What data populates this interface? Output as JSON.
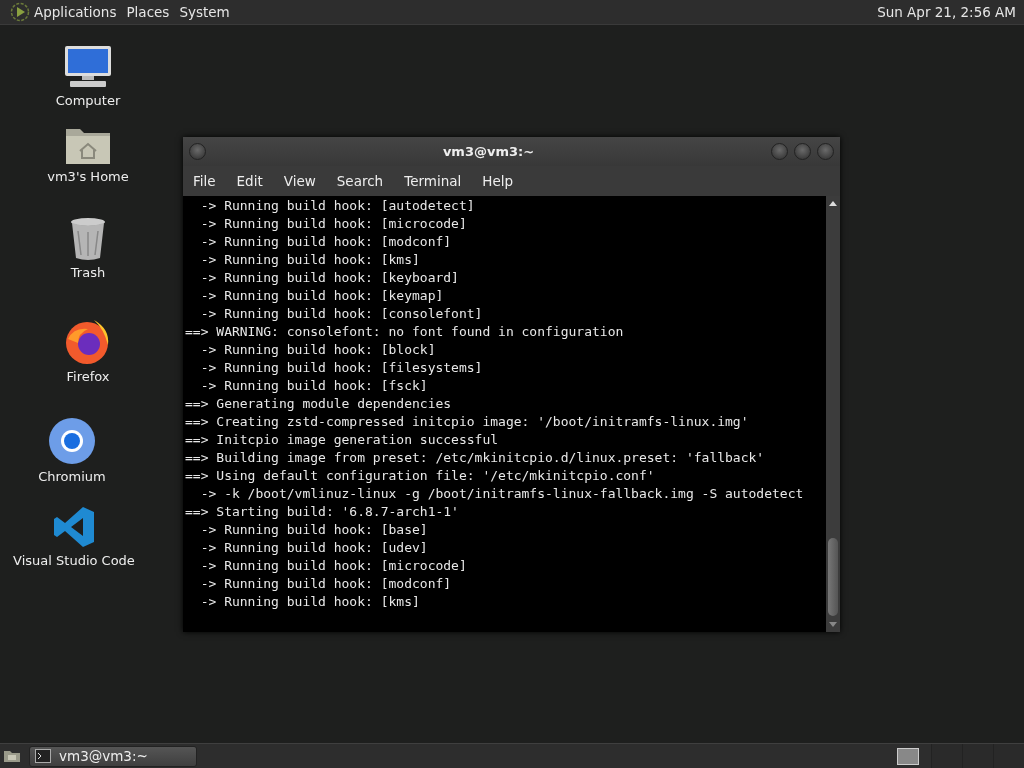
{
  "top_panel": {
    "menus": [
      "Applications",
      "Places",
      "System"
    ],
    "clock": "Sun Apr 21,  2:56 AM"
  },
  "desktop_icons": [
    {
      "kind": "computer",
      "label": "Computer"
    },
    {
      "kind": "home",
      "label": "vm3's Home"
    },
    {
      "kind": "trash",
      "label": "Trash"
    },
    {
      "kind": "firefox",
      "label": "Firefox"
    },
    {
      "kind": "chromium",
      "label": "Chromium"
    },
    {
      "kind": "vscode",
      "label": "Visual Studio Code"
    }
  ],
  "terminal_window": {
    "title": "vm3@vm3:~",
    "menu": [
      "File",
      "Edit",
      "View",
      "Search",
      "Terminal",
      "Help"
    ],
    "lines": [
      "  -> Running build hook: [autodetect]",
      "  -> Running build hook: [microcode]",
      "  -> Running build hook: [modconf]",
      "  -> Running build hook: [kms]",
      "  -> Running build hook: [keyboard]",
      "  -> Running build hook: [keymap]",
      "  -> Running build hook: [consolefont]",
      "==> WARNING: consolefont: no font found in configuration",
      "  -> Running build hook: [block]",
      "  -> Running build hook: [filesystems]",
      "  -> Running build hook: [fsck]",
      "==> Generating module dependencies",
      "==> Creating zstd-compressed initcpio image: '/boot/initramfs-linux.img'",
      "==> Initcpio image generation successful",
      "==> Building image from preset: /etc/mkinitcpio.d/linux.preset: 'fallback'",
      "==> Using default configuration file: '/etc/mkinitcpio.conf'",
      "  -> -k /boot/vmlinuz-linux -g /boot/initramfs-linux-fallback.img -S autodetect",
      "==> Starting build: '6.8.7-arch1-1'",
      "  -> Running build hook: [base]",
      "  -> Running build hook: [udev]",
      "  -> Running build hook: [microcode]",
      "  -> Running build hook: [modconf]",
      "  -> Running build hook: [kms]"
    ]
  },
  "taskbar": {
    "tasks": [
      {
        "label": "vm3@vm3:~",
        "selected": true
      }
    ]
  }
}
